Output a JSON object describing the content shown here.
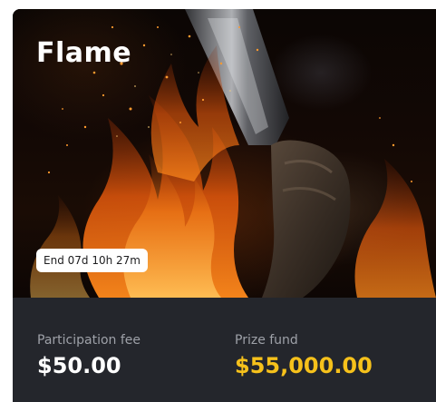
{
  "card": {
    "title": "Flame",
    "end_badge": "End 07d 10h 27m",
    "hero_image": "flame-torch-hand",
    "participation": {
      "label": "Participation fee",
      "value": "$50.00"
    },
    "prize": {
      "label": "Prize fund",
      "value": "$55,000.00"
    }
  },
  "colors": {
    "card_bg": "#24262c",
    "prize_accent": "#f6c11b",
    "label_gray": "#9ea1a8",
    "badge_bg": "#ffffff"
  }
}
